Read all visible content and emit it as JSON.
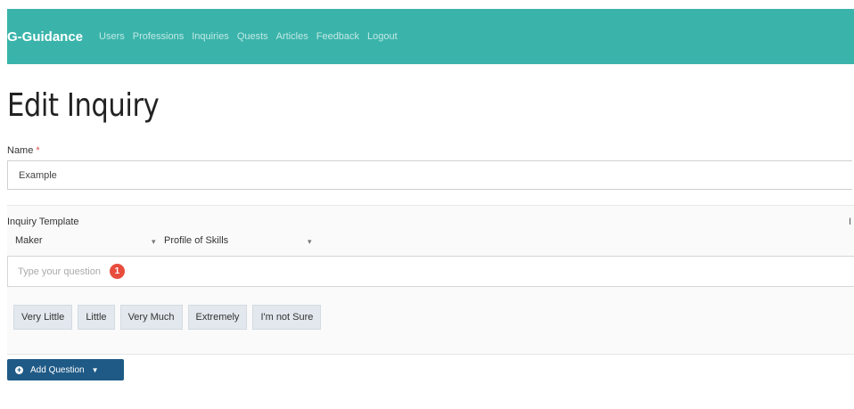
{
  "nav": {
    "brand": "G-Guidance",
    "links": [
      "Users",
      "Professions",
      "Inquiries",
      "Quests",
      "Articles",
      "Feedback",
      "Logout"
    ]
  },
  "page": {
    "title": "Edit Inquiry"
  },
  "form": {
    "name_label": "Name",
    "name_required": "*",
    "name_value": "Example"
  },
  "template": {
    "label": "Inquiry Template",
    "right_mark": "I",
    "maker_select": "Maker",
    "profile_select": "Profile of Skills",
    "question_placeholder": "Type your question",
    "badge": "1",
    "answers": [
      "Very Little",
      "Little",
      "Very Much",
      "Extremely",
      "I'm not Sure"
    ]
  },
  "actions": {
    "add_question": "Add Question"
  },
  "colors": {
    "navbar": "#3ab4ab",
    "button": "#1f5a86",
    "badge": "#e74c3c"
  }
}
